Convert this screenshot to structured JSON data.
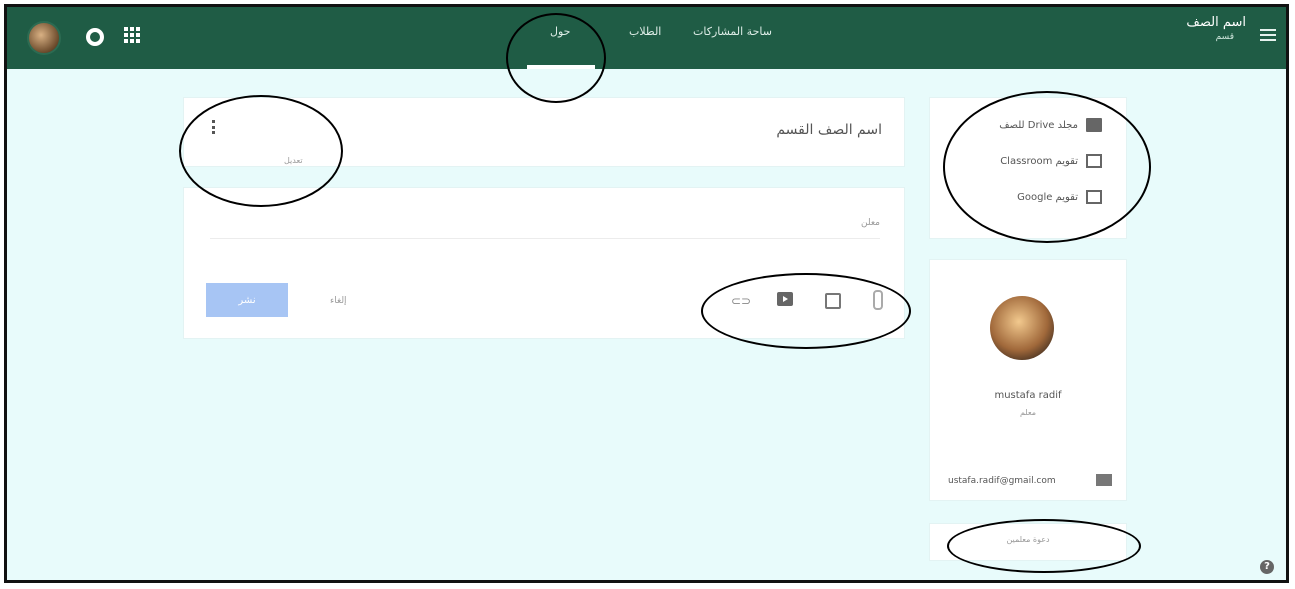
{
  "header": {
    "course_title": "اسم الصف",
    "course_subtitle": "قسم",
    "tabs": [
      "حول",
      "الطلاب",
      "ساحة المشاركات"
    ],
    "active_tab": "حول"
  },
  "course_card": {
    "title": "اسم الصف القسم",
    "edit_label": "تعديل"
  },
  "composer": {
    "placeholder": "معلن",
    "post_button": "نشر",
    "cancel_label": "إلغاء",
    "tool_icons": [
      "youtube-icon",
      "drive-icon",
      "attachment-icon",
      "link-icon"
    ]
  },
  "side_links": [
    {
      "icon": "folder-icon",
      "label": "مجلد Drive للصف"
    },
    {
      "icon": "calendar-icon",
      "label": "تقويم Classroom"
    },
    {
      "icon": "external-icon",
      "label": "تقويم Google"
    }
  ],
  "teacher": {
    "name": "mustafa radif",
    "role": "معلم",
    "email": "ustafa.radif@gmail.com"
  },
  "invite_label": "دعوة معلمين",
  "colors": {
    "topbar": "#1f5c45",
    "page_background": "#e8fbfb",
    "post_button": "#a7c5f4"
  }
}
